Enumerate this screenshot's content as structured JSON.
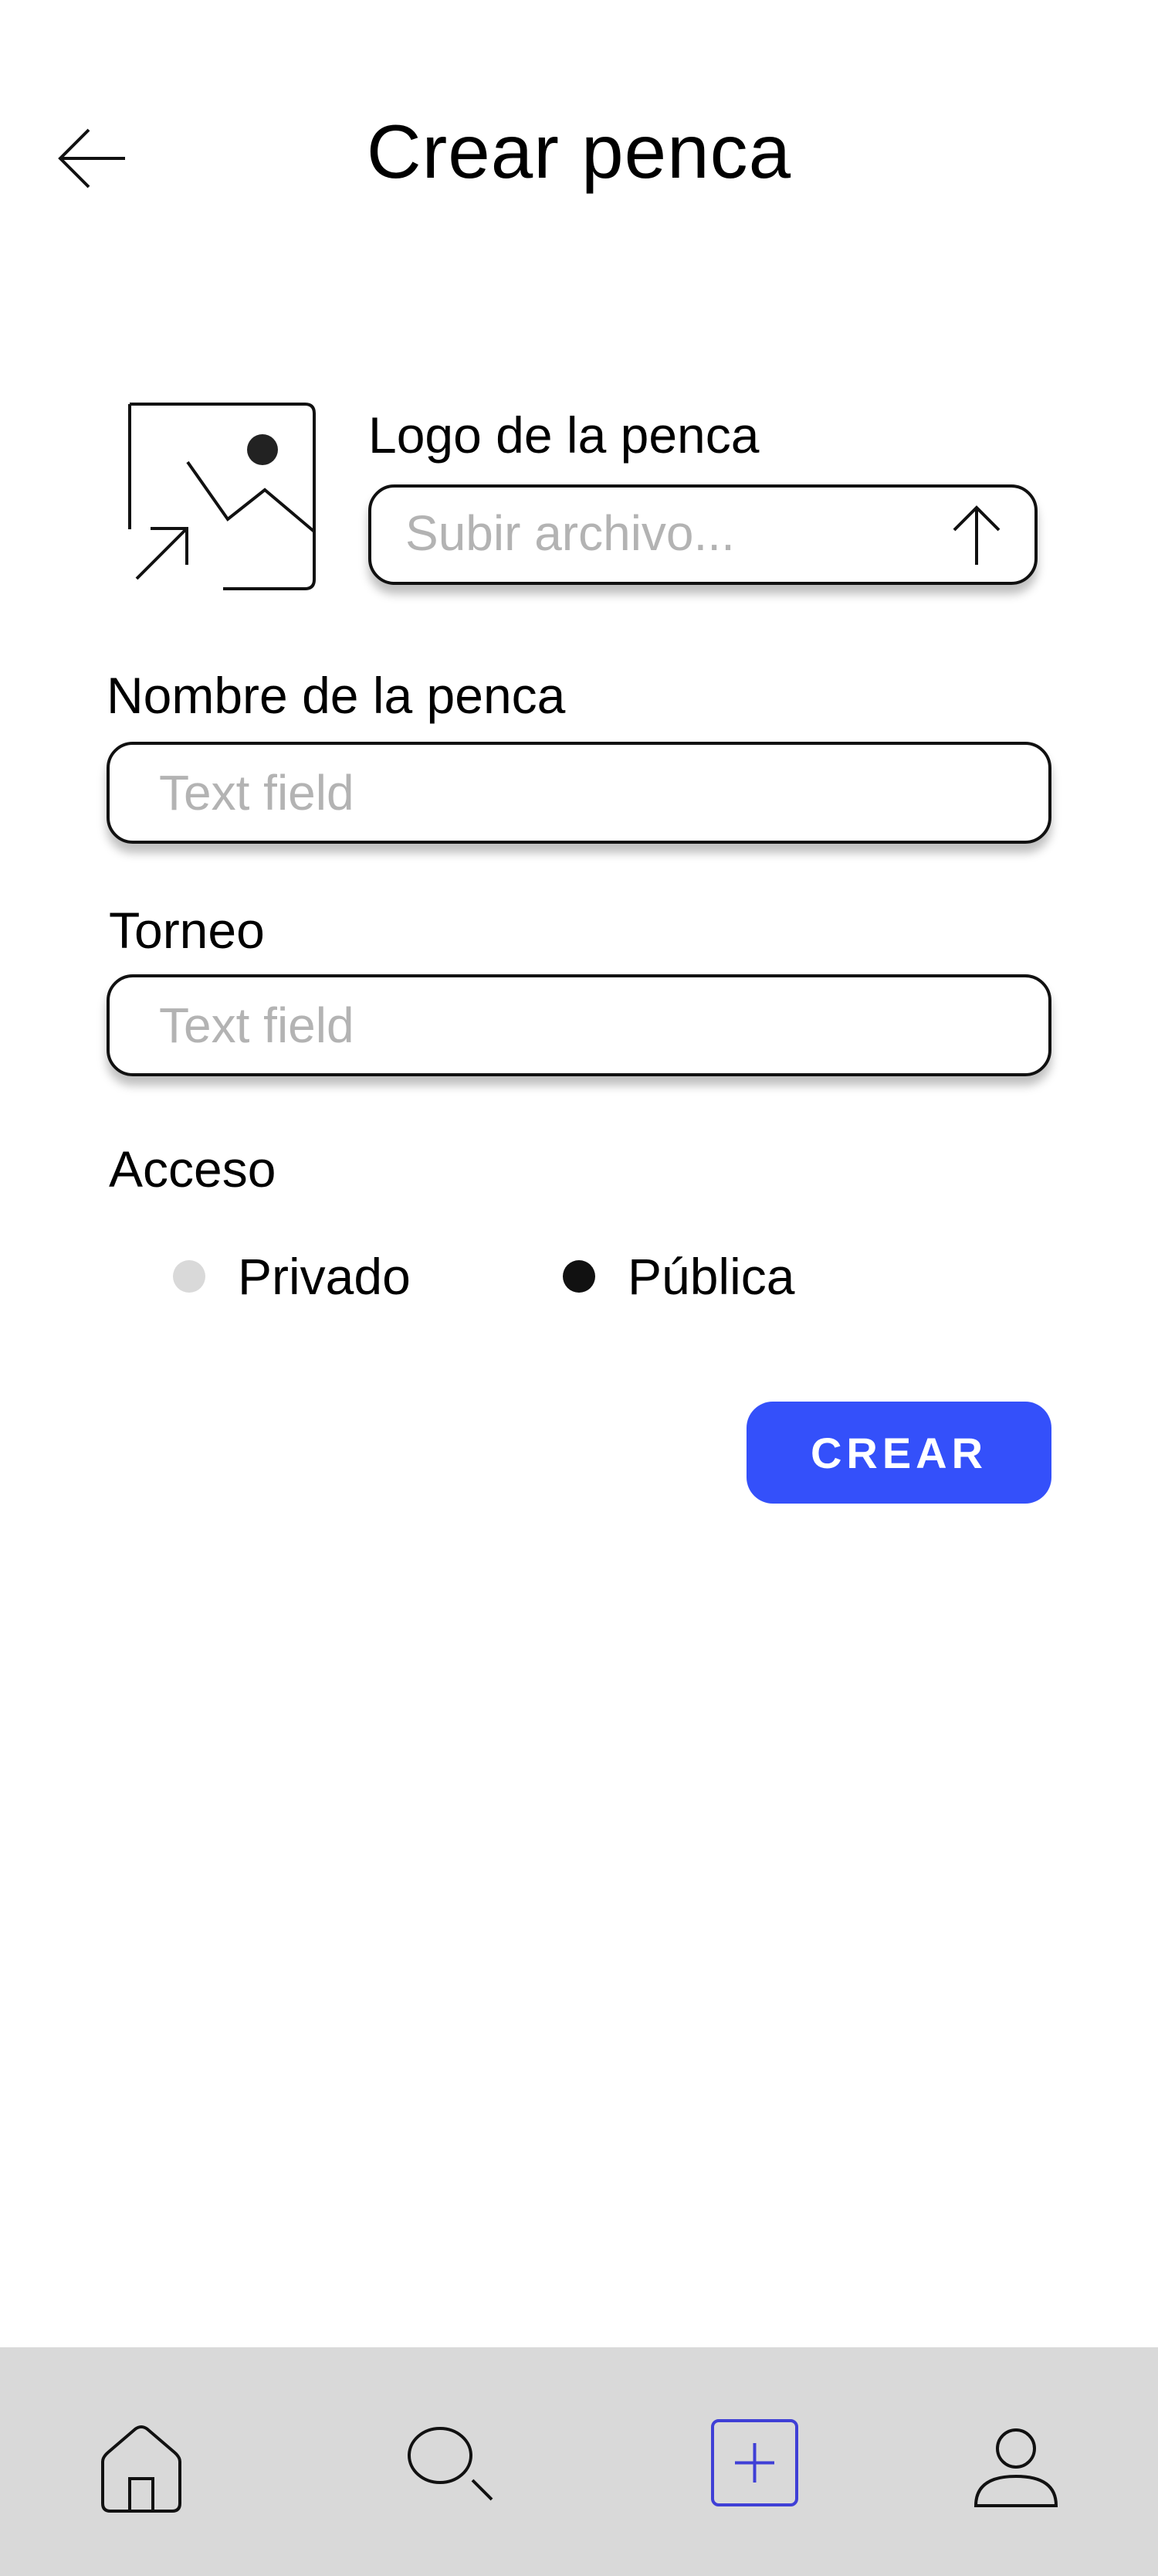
{
  "header": {
    "back_icon": "arrow-left-icon",
    "title": "Crear penca"
  },
  "logo": {
    "placeholder_icon": "image-placeholder-icon",
    "label": "Logo de la penca",
    "upload_placeholder": "Subir archivo...",
    "upload_icon": "arrow-up-icon"
  },
  "nombre": {
    "label": "Nombre de la penca",
    "placeholder": "Text field"
  },
  "torneo": {
    "label": "Torneo",
    "placeholder": "Text field"
  },
  "acceso": {
    "label": "Acceso",
    "options": [
      {
        "label": "Privado",
        "selected": false
      },
      {
        "label": "Pública",
        "selected": true
      }
    ]
  },
  "submit": {
    "label": "CREAR",
    "color": "#3450fa"
  },
  "nav": {
    "items": [
      {
        "icon": "home-icon",
        "active": false
      },
      {
        "icon": "search-icon",
        "active": false
      },
      {
        "icon": "add-square-icon",
        "active": true,
        "color": "#3f3fd6"
      },
      {
        "icon": "user-icon",
        "active": false
      }
    ],
    "background": "#d9d9d9"
  }
}
